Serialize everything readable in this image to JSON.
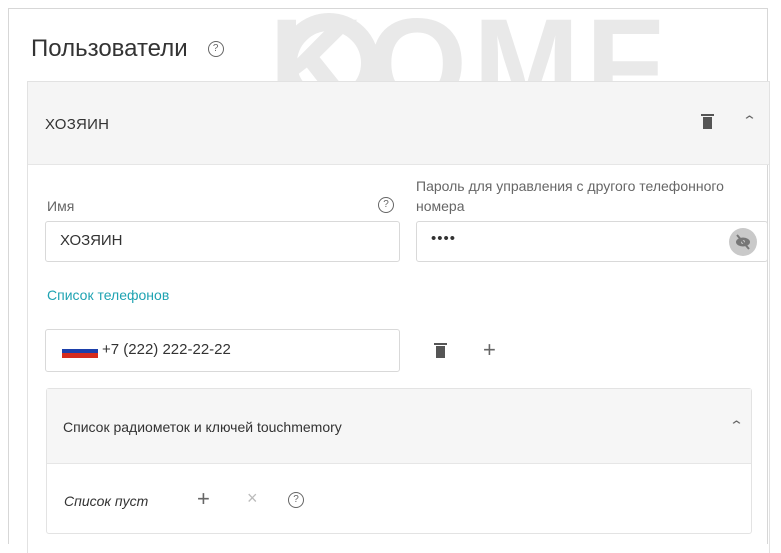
{
  "watermark": "KOMF",
  "page": {
    "title": "Пользователи"
  },
  "user": {
    "header_name": "ХОЗЯИН",
    "name_label": "Имя",
    "name_value": "ХОЗЯИН",
    "password_label": "Пароль для управления с другого телефонного номера",
    "password_value": "••••",
    "phones_label": "Список телефонов",
    "phone_value": "+7 (222) 222-22-22",
    "flag_colors": [
      "#ffffff",
      "#1c3faa",
      "#d52b1e"
    ]
  },
  "touchmemory": {
    "title": "Список радиометок и ключей touchmemory",
    "empty_label": "Список пуст"
  },
  "icons": {
    "help": "?",
    "plus": "+",
    "close": "×",
    "chevron_up": "⌃"
  }
}
